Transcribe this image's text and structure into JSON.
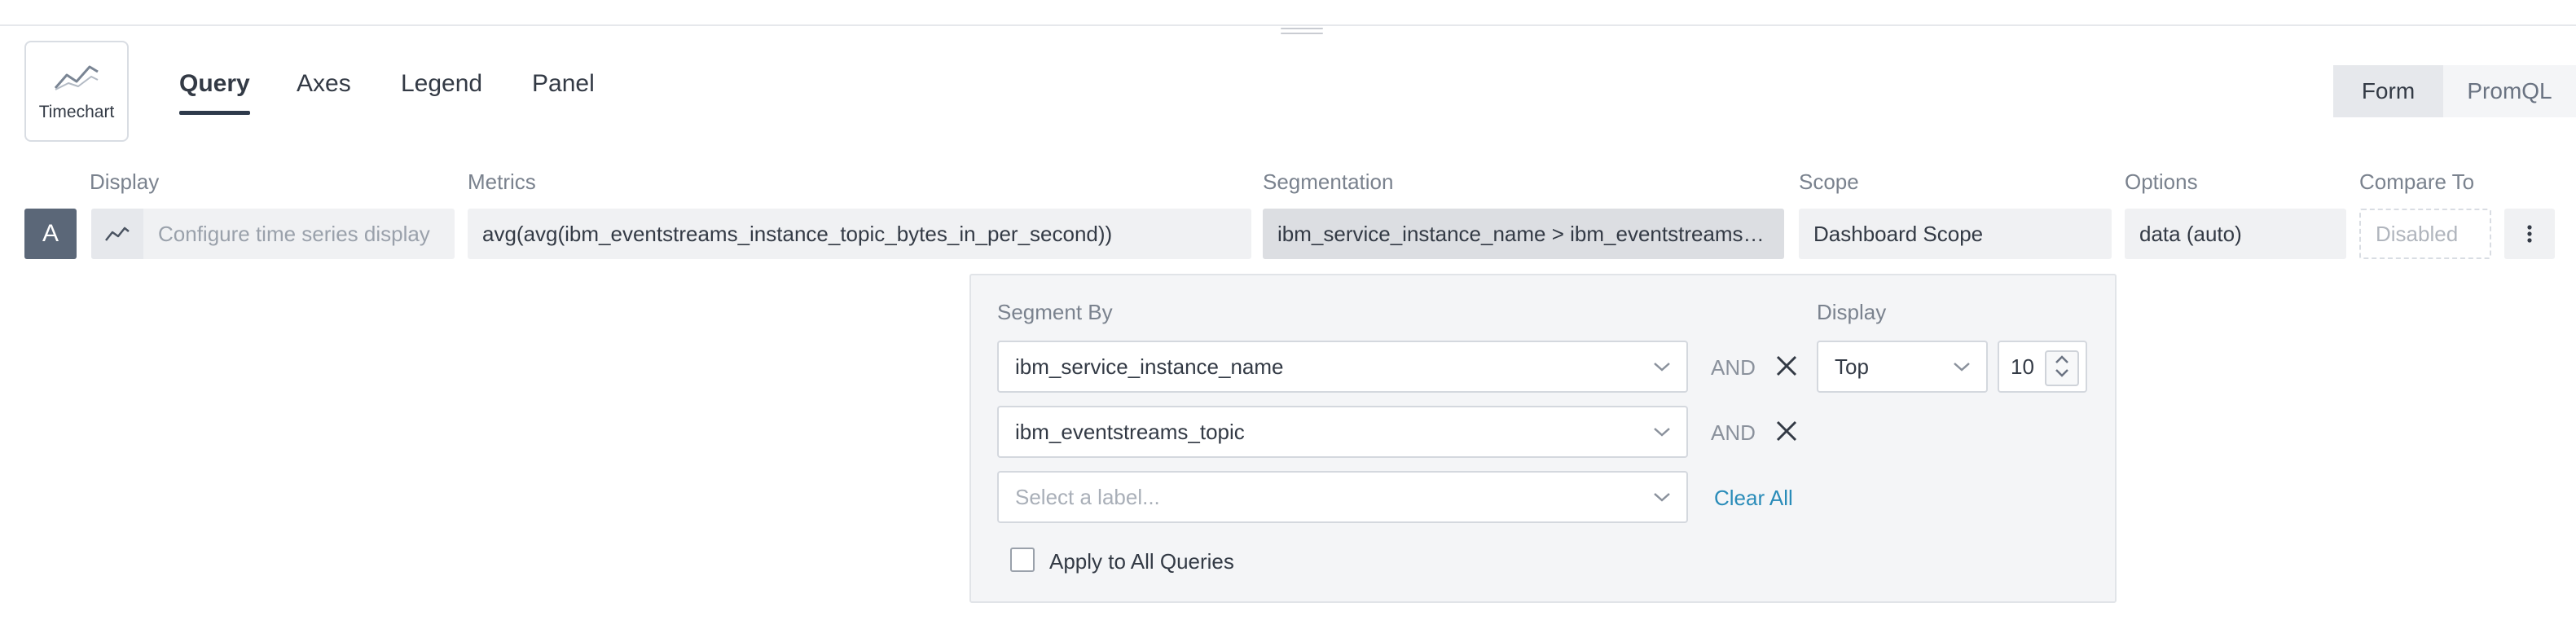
{
  "chart_type": {
    "label": "Timechart",
    "icon": "line-chart-icon"
  },
  "tabs": [
    {
      "label": "Query",
      "active": true
    },
    {
      "label": "Axes",
      "active": false
    },
    {
      "label": "Legend",
      "active": false
    },
    {
      "label": "Panel",
      "active": false
    }
  ],
  "mode_toggle": {
    "form": "Form",
    "promql": "PromQL",
    "selected": "Form"
  },
  "columns": {
    "display": "Display",
    "metrics": "Metrics",
    "segmentation": "Segmentation",
    "scope": "Scope",
    "options": "Options",
    "compare_to": "Compare To"
  },
  "query": {
    "letter": "A",
    "display_placeholder": "Configure time series display",
    "metrics": "avg(avg(ibm_eventstreams_instance_topic_bytes_in_per_second))",
    "segmentation": "ibm_service_instance_name > ibm_eventstreams_topic",
    "scope": "Dashboard Scope",
    "options": "data (auto)",
    "compare_to": "Disabled"
  },
  "segment_panel": {
    "segment_by_label": "Segment By",
    "display_label": "Display",
    "segments": [
      {
        "value": "ibm_service_instance_name",
        "joiner": "AND"
      },
      {
        "value": "ibm_eventstreams_topic",
        "joiner": "AND"
      }
    ],
    "new_segment_placeholder": "Select a label...",
    "clear_all": "Clear All",
    "display_mode": "Top",
    "display_limit": "10",
    "apply_all_label": "Apply to All Queries",
    "apply_all_checked": false
  },
  "colors": {
    "accent": "#2a8cb9",
    "query_letter_bg": "#5b6778",
    "tab_underline": "#2e3a4b"
  }
}
